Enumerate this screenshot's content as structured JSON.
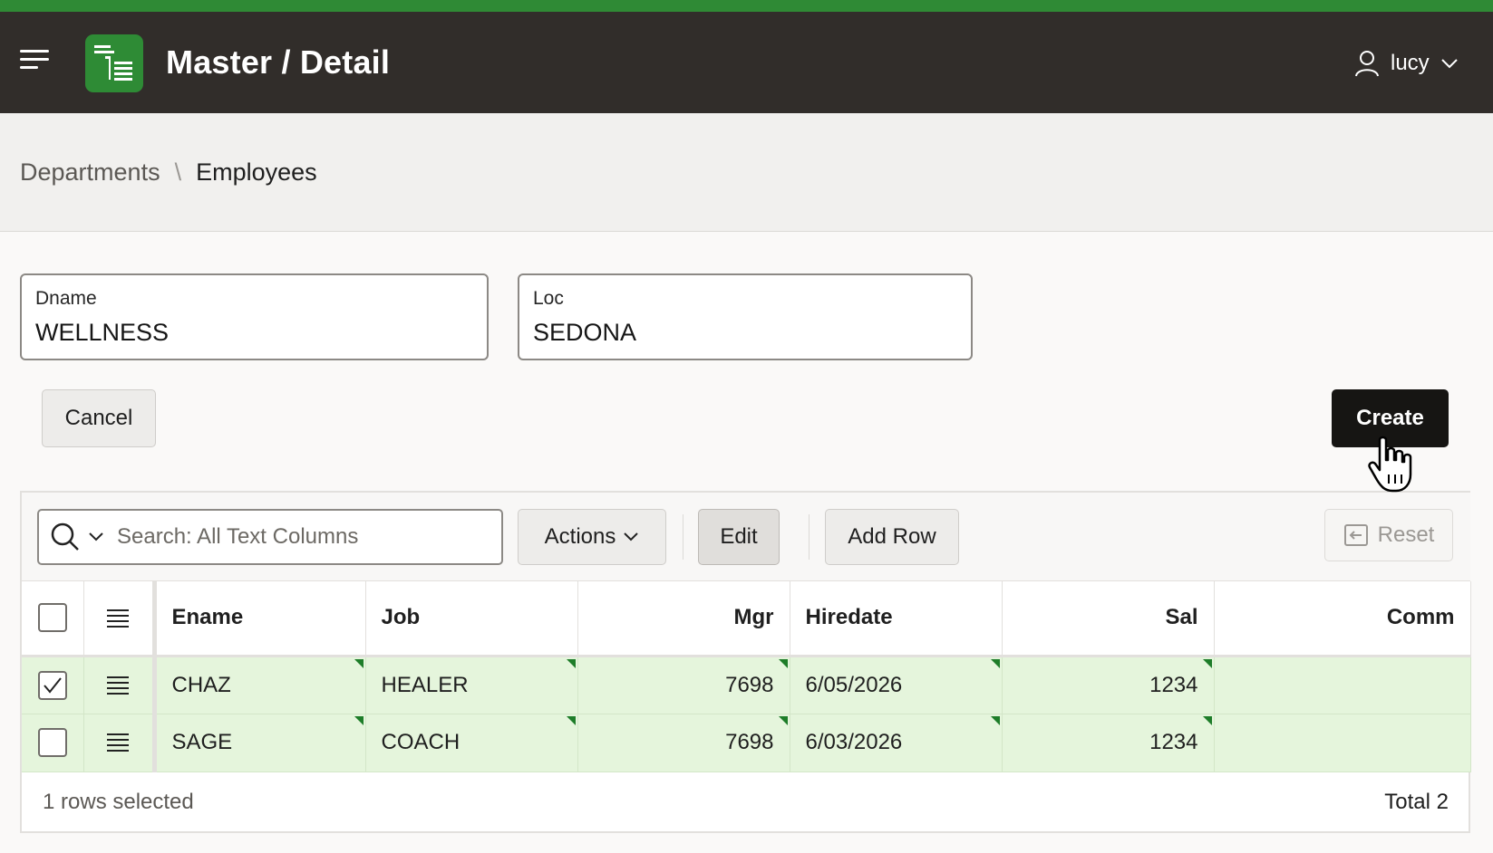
{
  "app": {
    "title": "Master / Detail",
    "user": "lucy"
  },
  "breadcrumb": {
    "parent": "Departments",
    "separator": "\\",
    "current": "Employees"
  },
  "form": {
    "dname": {
      "label": "Dname",
      "value": "WELLNESS"
    },
    "loc": {
      "label": "Loc",
      "value": "SEDONA"
    }
  },
  "buttons": {
    "cancel": "Cancel",
    "create": "Create"
  },
  "grid": {
    "search_placeholder": "Search: All Text Columns",
    "toolbar": {
      "actions": "Actions",
      "edit": "Edit",
      "add_row": "Add Row",
      "reset": "Reset"
    },
    "columns": [
      "Ename",
      "Job",
      "Mgr",
      "Hiredate",
      "Sal",
      "Comm"
    ],
    "rows": [
      {
        "selected": true,
        "ename": "CHAZ",
        "job": "HEALER",
        "mgr": "7698",
        "hiredate": "6/05/2026",
        "sal": "1234",
        "comm": ""
      },
      {
        "selected": false,
        "ename": "SAGE",
        "job": "COACH",
        "mgr": "7698",
        "hiredate": "6/03/2026",
        "sal": "1234",
        "comm": ""
      }
    ],
    "footer": {
      "selected": "1 rows selected",
      "total": "Total 2"
    }
  },
  "colors": {
    "brand_green": "#2f8a35",
    "header_bg": "#312d2a",
    "row_changed": "#e5f5dc",
    "create_bg": "#161513"
  },
  "icons": [
    "hamburger-icon",
    "app-logo-icon",
    "user-icon",
    "chevron-down-icon",
    "search-icon",
    "reset-icon",
    "row-menu-icon",
    "checkbox-icon",
    "hand-cursor-icon"
  ]
}
